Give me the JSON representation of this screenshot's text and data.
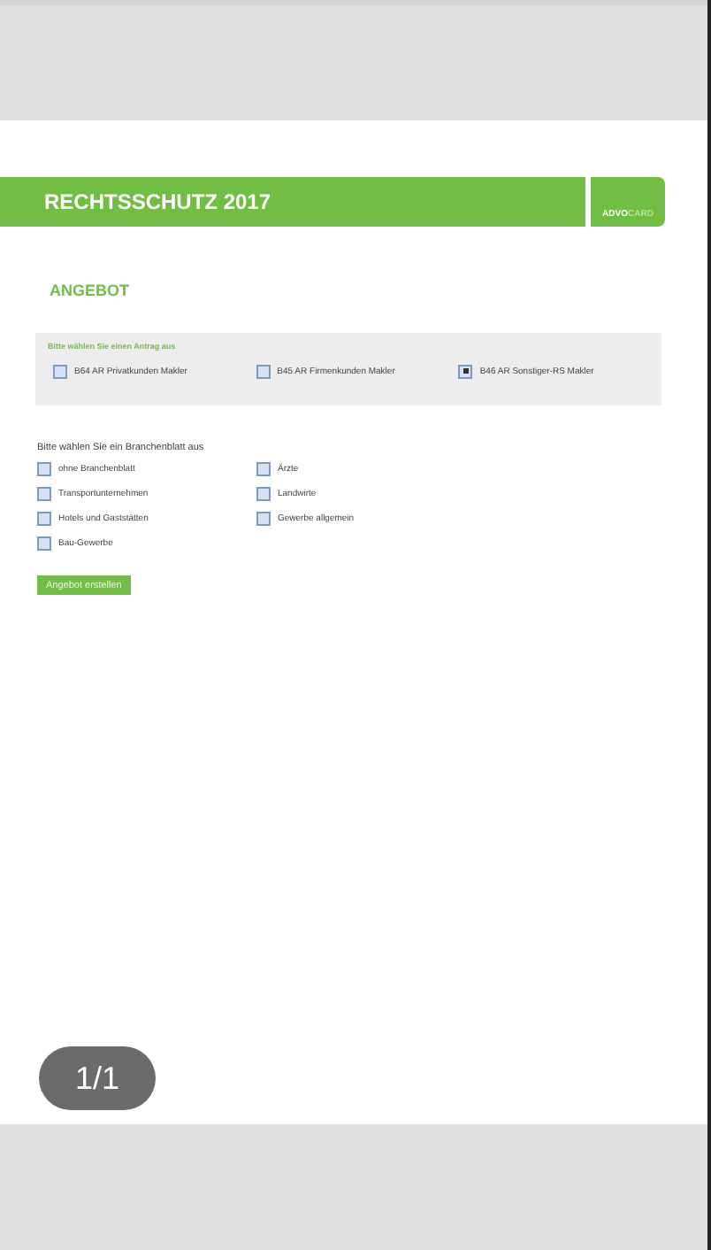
{
  "header": {
    "title": "RECHTSSCHUTZ 2017",
    "logo": {
      "first": "ADVO",
      "second": "CARD"
    }
  },
  "heading": "ANGEBOT",
  "antrag": {
    "prompt": "Bitte wählen Sie einen Antrag aus",
    "options": [
      {
        "label": "B64 AR Privatkunden Makler",
        "checked": false
      },
      {
        "label": "B45 AR Firmenkunden Makler",
        "checked": false
      },
      {
        "label": "B46 AR Sonstiger-RS Makler",
        "checked": true
      }
    ]
  },
  "branchen": {
    "prompt": "Bitte wählen Sie ein Branchenblatt aus",
    "options": [
      {
        "label": "ohne Branchenblatt",
        "checked": false
      },
      {
        "label": "Ärzte",
        "checked": false
      },
      {
        "label": "Transportunternehmen",
        "checked": false
      },
      {
        "label": "Landwirte",
        "checked": false
      },
      {
        "label": "Hotels und Gaststätten",
        "checked": false
      },
      {
        "label": "Gewerbe allgemein",
        "checked": false
      },
      {
        "label": "Bau-Gewerbe",
        "checked": false
      }
    ]
  },
  "submit": "Angebot erstellen",
  "page_counter": "1/1"
}
